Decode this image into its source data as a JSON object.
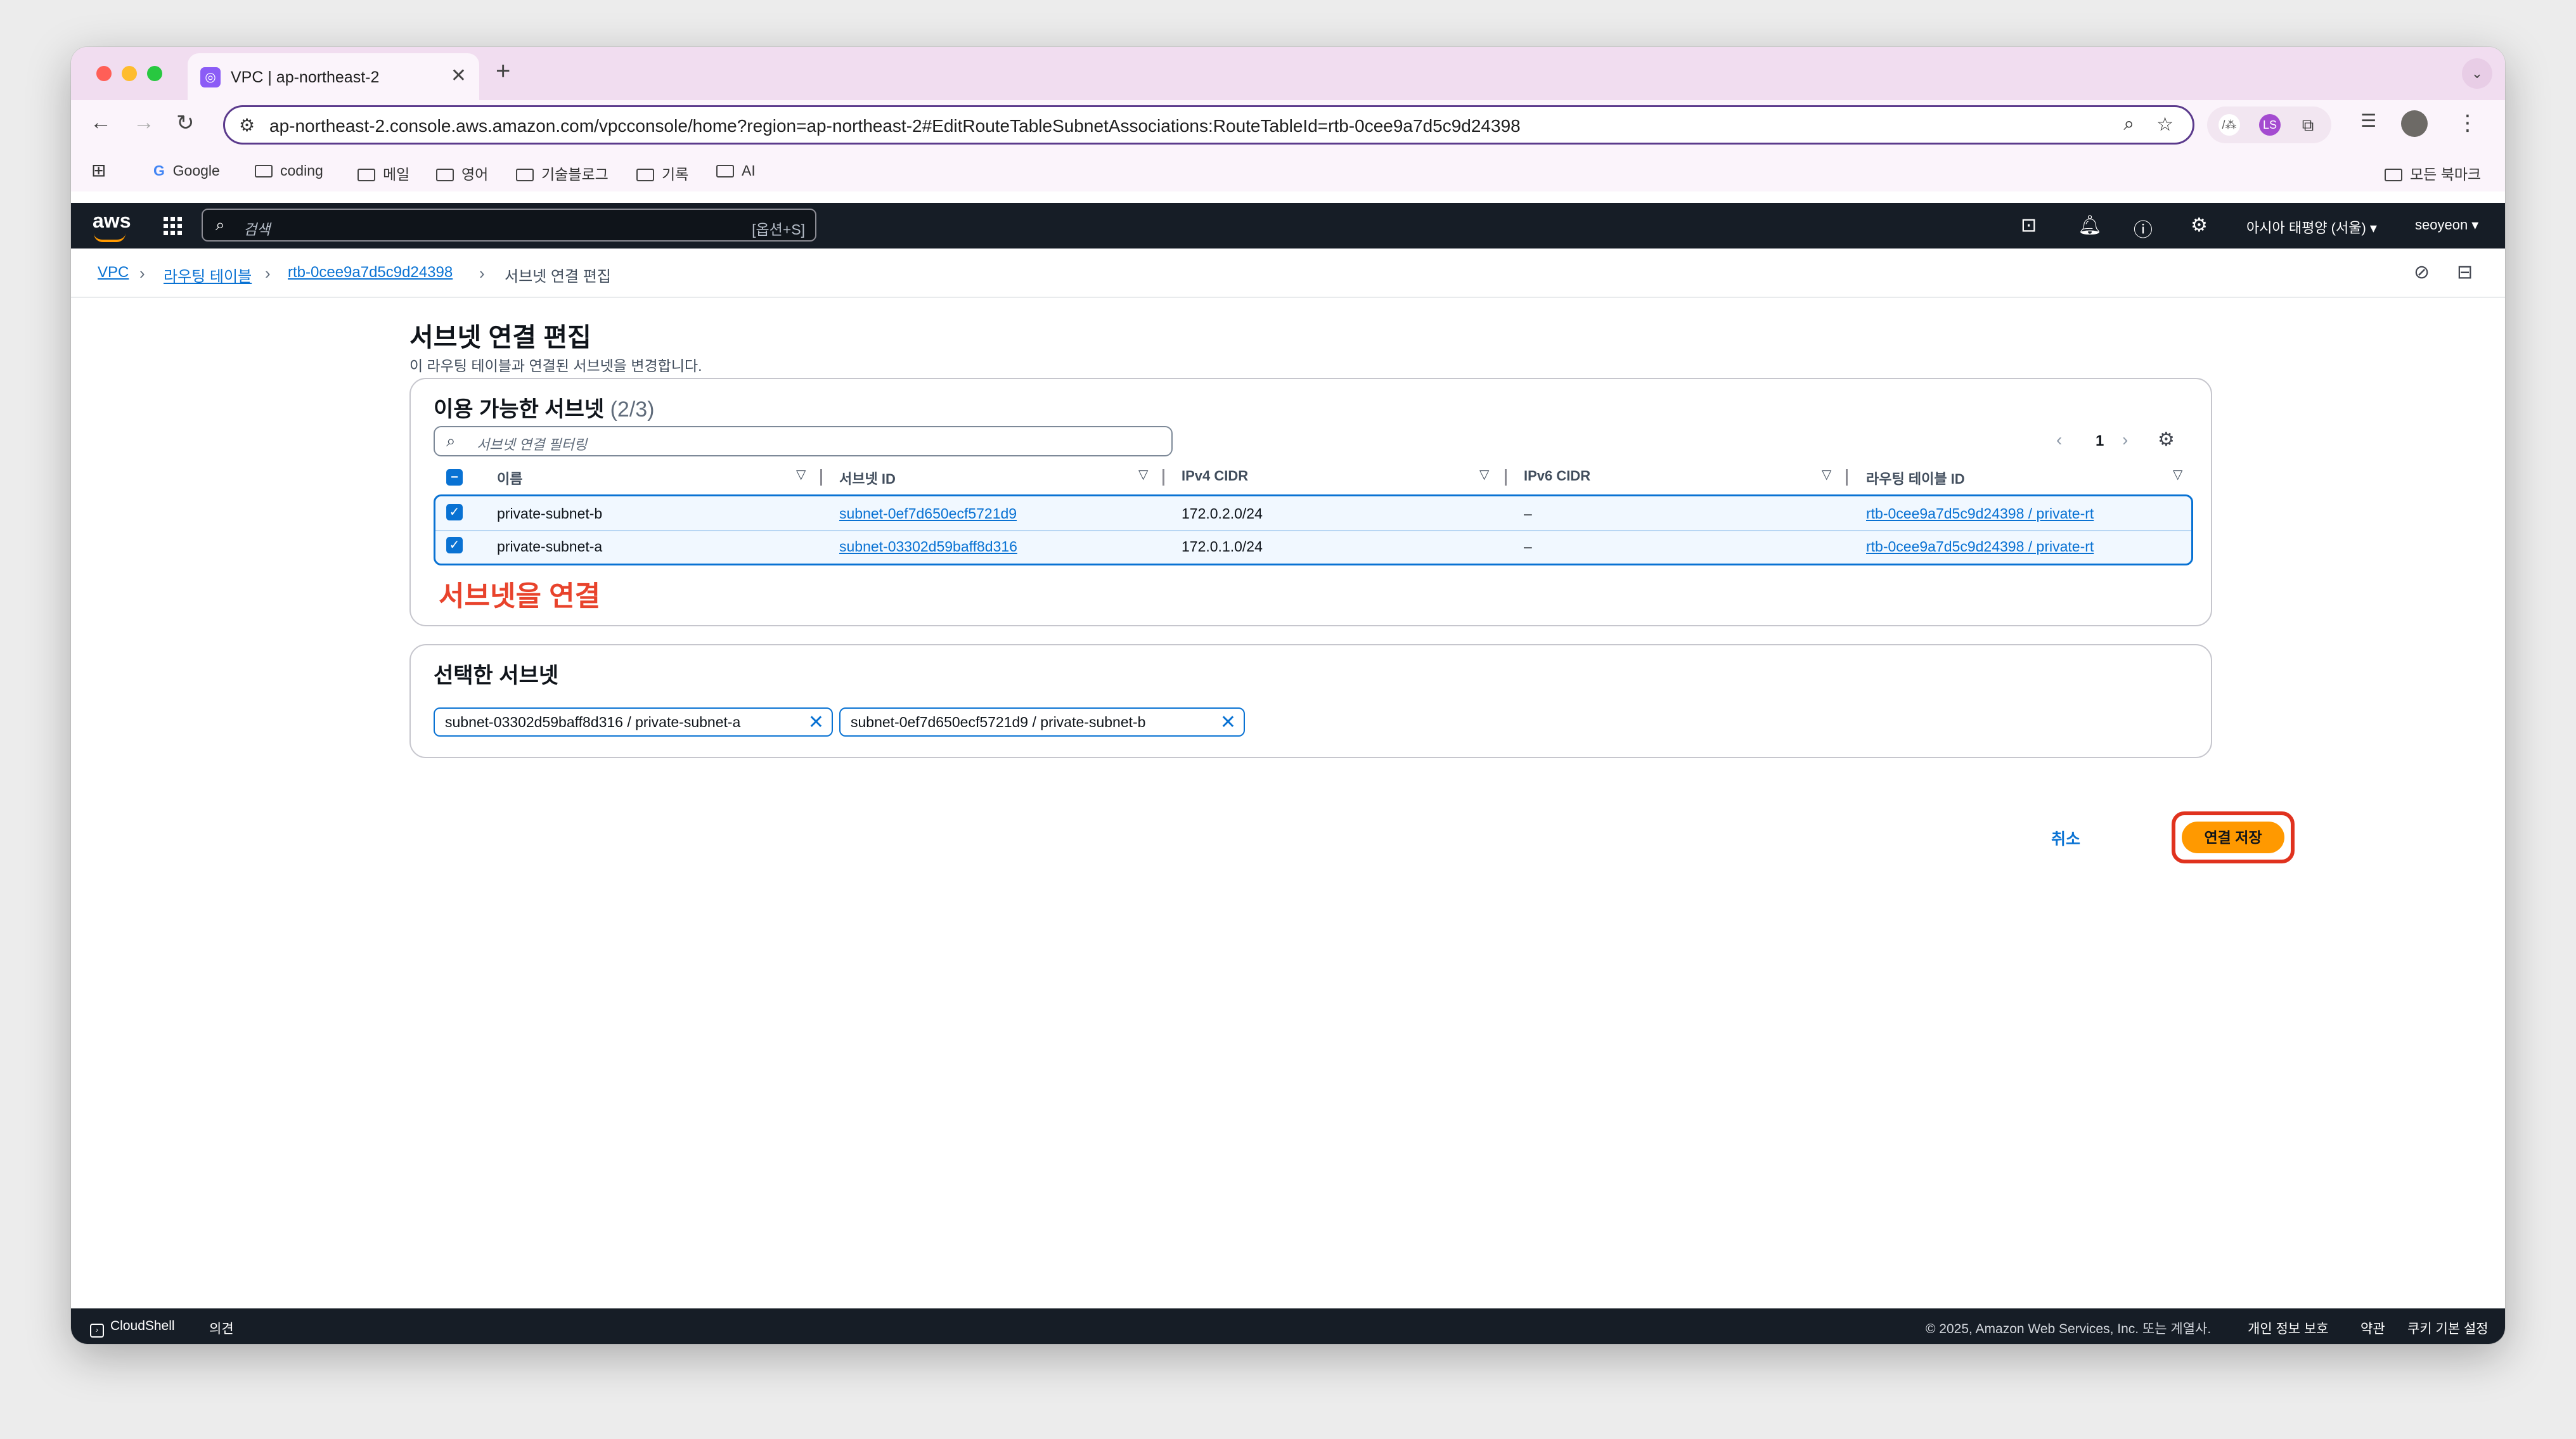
{
  "browser": {
    "tab_title": "VPC | ap-northeast-2",
    "tab_close": "✕",
    "new_tab": "+",
    "url": "ap-northeast-2.console.aws.amazon.com/vpcconsole/home?region=ap-northeast-2#EditRouteTableSubnetAssociations:RouteTableId=rtb-0cee9a7d5c9d24398",
    "bookmarks": [
      "Google",
      "coding",
      "메일",
      "영어",
      "기술블로그",
      "기록",
      "AI"
    ],
    "all_bookmarks": "모든 북마크",
    "profile_badge": "LS"
  },
  "aws_nav": {
    "logo": "aws",
    "search_placeholder": "검색",
    "search_shortcut": "[옵션+S]",
    "region": "아시아 태평양 (서울) ▾",
    "user": "seoyeon ▾"
  },
  "breadcrumb": [
    "VPC",
    "라우팅 테이블",
    "rtb-0cee9a7d5c9d24398",
    "서브넷 연결 편집"
  ],
  "page": {
    "title": "서브넷 연결 편집",
    "description": "이 라우팅 테이블과 연결된 서브넷을 변경합니다."
  },
  "available": {
    "title": "이용 가능한 서브넷",
    "count": "(2/3)",
    "filter_placeholder": "서브넷 연결 필터링",
    "page_number": "1",
    "columns": [
      "이름",
      "서브넷 ID",
      "IPv4 CIDR",
      "IPv6 CIDR",
      "라우팅 테이블 ID"
    ],
    "rows": [
      {
        "name": "private-subnet-b",
        "subnet_id": "subnet-0ef7d650ecf5721d9",
        "ipv4": "172.0.2.0/24",
        "ipv6": "–",
        "route_table": "rtb-0cee9a7d5c9d24398 / private-rt",
        "checked": true
      },
      {
        "name": "private-subnet-a",
        "subnet_id": "subnet-03302d59baff8d316",
        "ipv4": "172.0.1.0/24",
        "ipv6": "–",
        "route_table": "rtb-0cee9a7d5c9d24398 / private-rt",
        "checked": true
      }
    ],
    "annotation": "서브넷을 연결"
  },
  "selected": {
    "title": "선택한 서브넷",
    "tokens": [
      "subnet-03302d59baff8d316 / private-subnet-a",
      "subnet-0ef7d650ecf5721d9 / private-subnet-b"
    ]
  },
  "actions": {
    "cancel": "취소",
    "save": "연결 저장"
  },
  "footer": {
    "cloudshell": "CloudShell",
    "feedback": "의견",
    "copyright": "© 2025, Amazon Web Services, Inc. 또는 계열사.",
    "privacy": "개인 정보 보호",
    "terms": "약관",
    "cookies": "쿠키 기본 설정"
  },
  "colors": {
    "accent": "#0972d3",
    "brand": "#ff9900",
    "annotation": "#e8432c",
    "nav": "#161d26"
  }
}
